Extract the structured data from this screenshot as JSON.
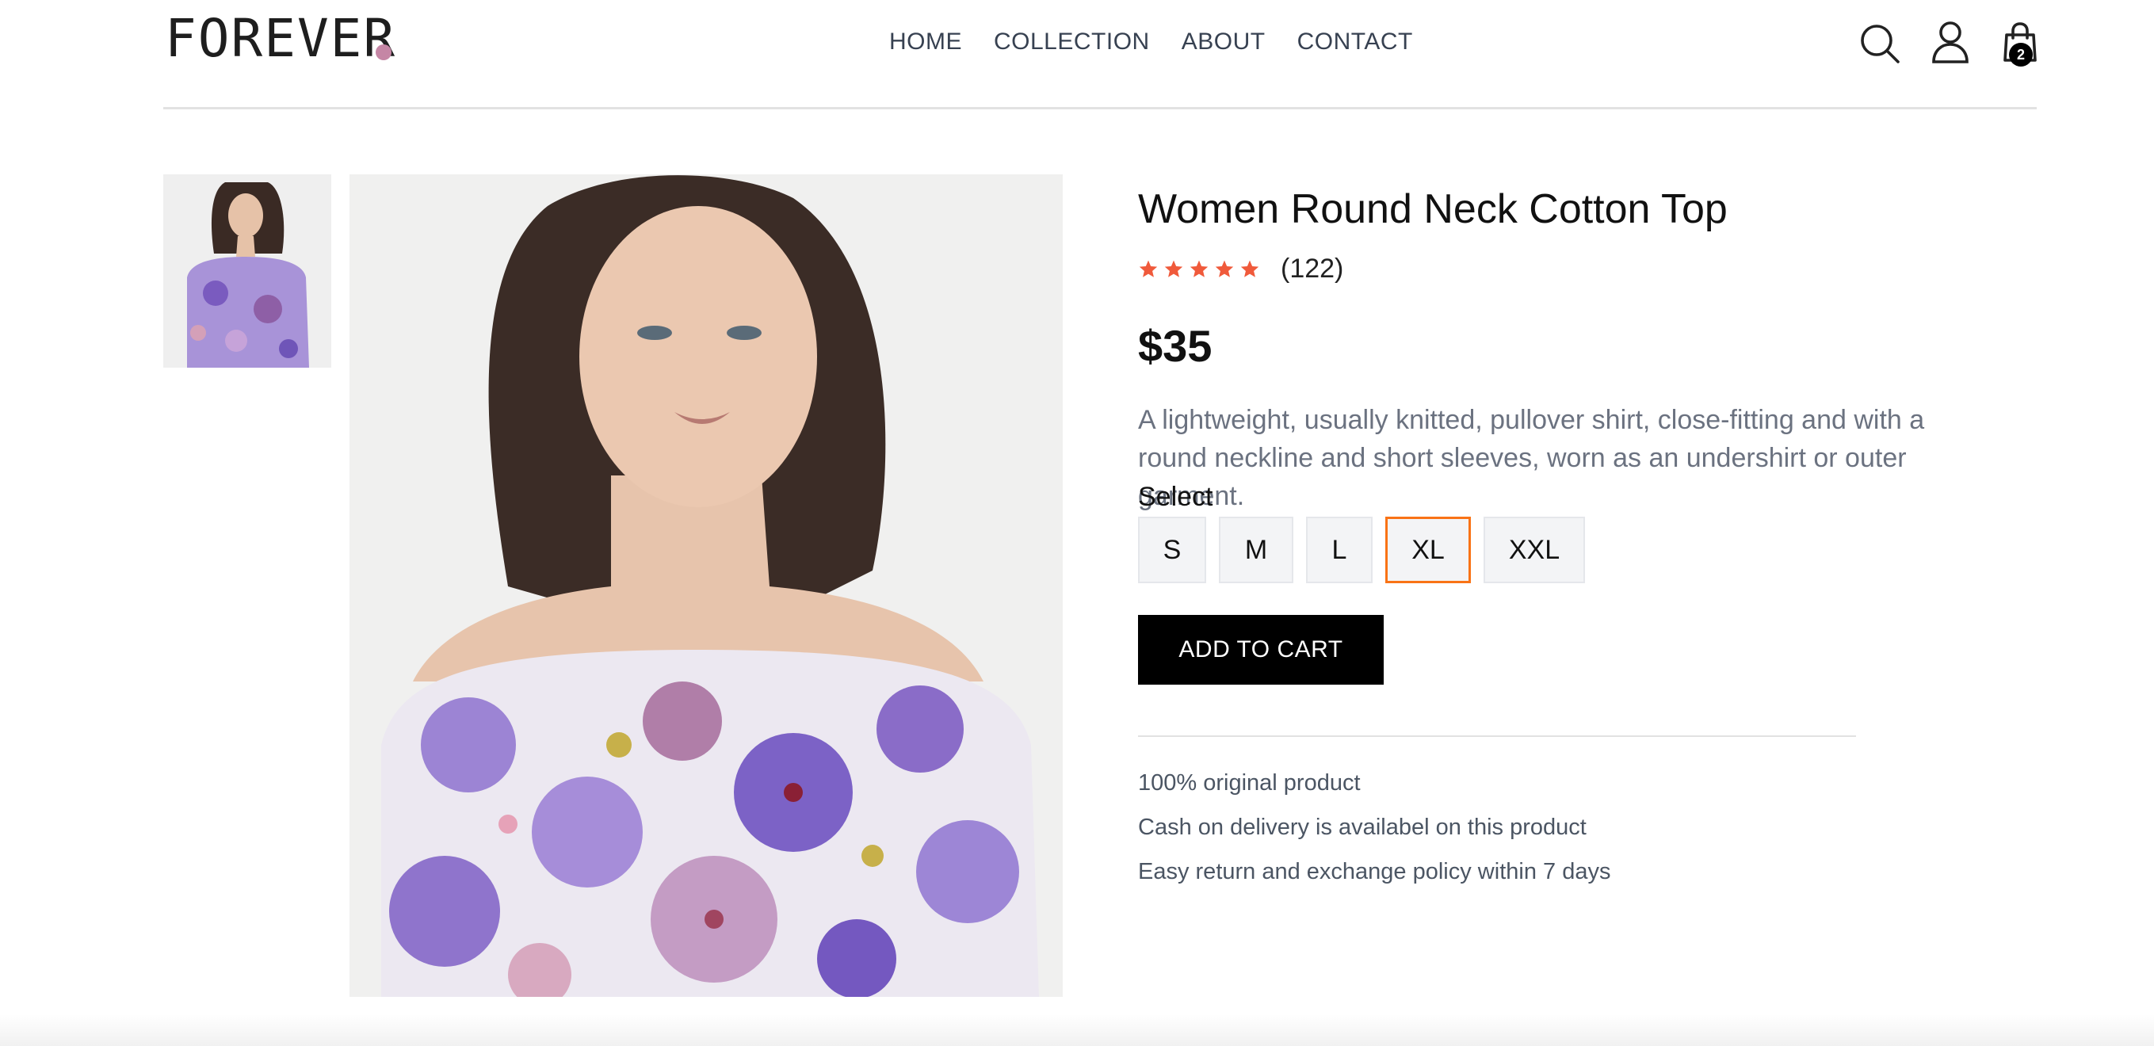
{
  "header": {
    "logo_text": "FOREVER",
    "nav": [
      {
        "label": "HOME"
      },
      {
        "label": "COLLECTION"
      },
      {
        "label": "ABOUT"
      },
      {
        "label": "CONTACT"
      }
    ],
    "icons": {
      "search": "search-icon",
      "profile": "user-icon",
      "cart": "shopping-bag-icon"
    },
    "cart_count": "2",
    "logo_dot_color": "#c586a5"
  },
  "product": {
    "title": "Women Round Neck Cotton Top",
    "rating_stars": 5,
    "rating_count": "(122)",
    "price": "$35",
    "description": "A lightweight, usually knitted, pullover shirt, close-fitting and with a round neckline and short sleeves, worn as an undershirt or outer garment.",
    "select_label": "Select",
    "sizes": [
      {
        "label": "S"
      },
      {
        "label": "M"
      },
      {
        "label": "L"
      },
      {
        "label": "XL"
      },
      {
        "label": "XXL"
      }
    ],
    "selected_size": "XL",
    "add_to_cart_label": "ADD TO CART",
    "policies": [
      "100% original product",
      "Cash on delivery is availabel on this product",
      "Easy return and exchange policy within 7 days"
    ]
  },
  "colors": {
    "star": "#f05a3b",
    "selected_border": "#f97316",
    "button_bg": "#000000"
  }
}
